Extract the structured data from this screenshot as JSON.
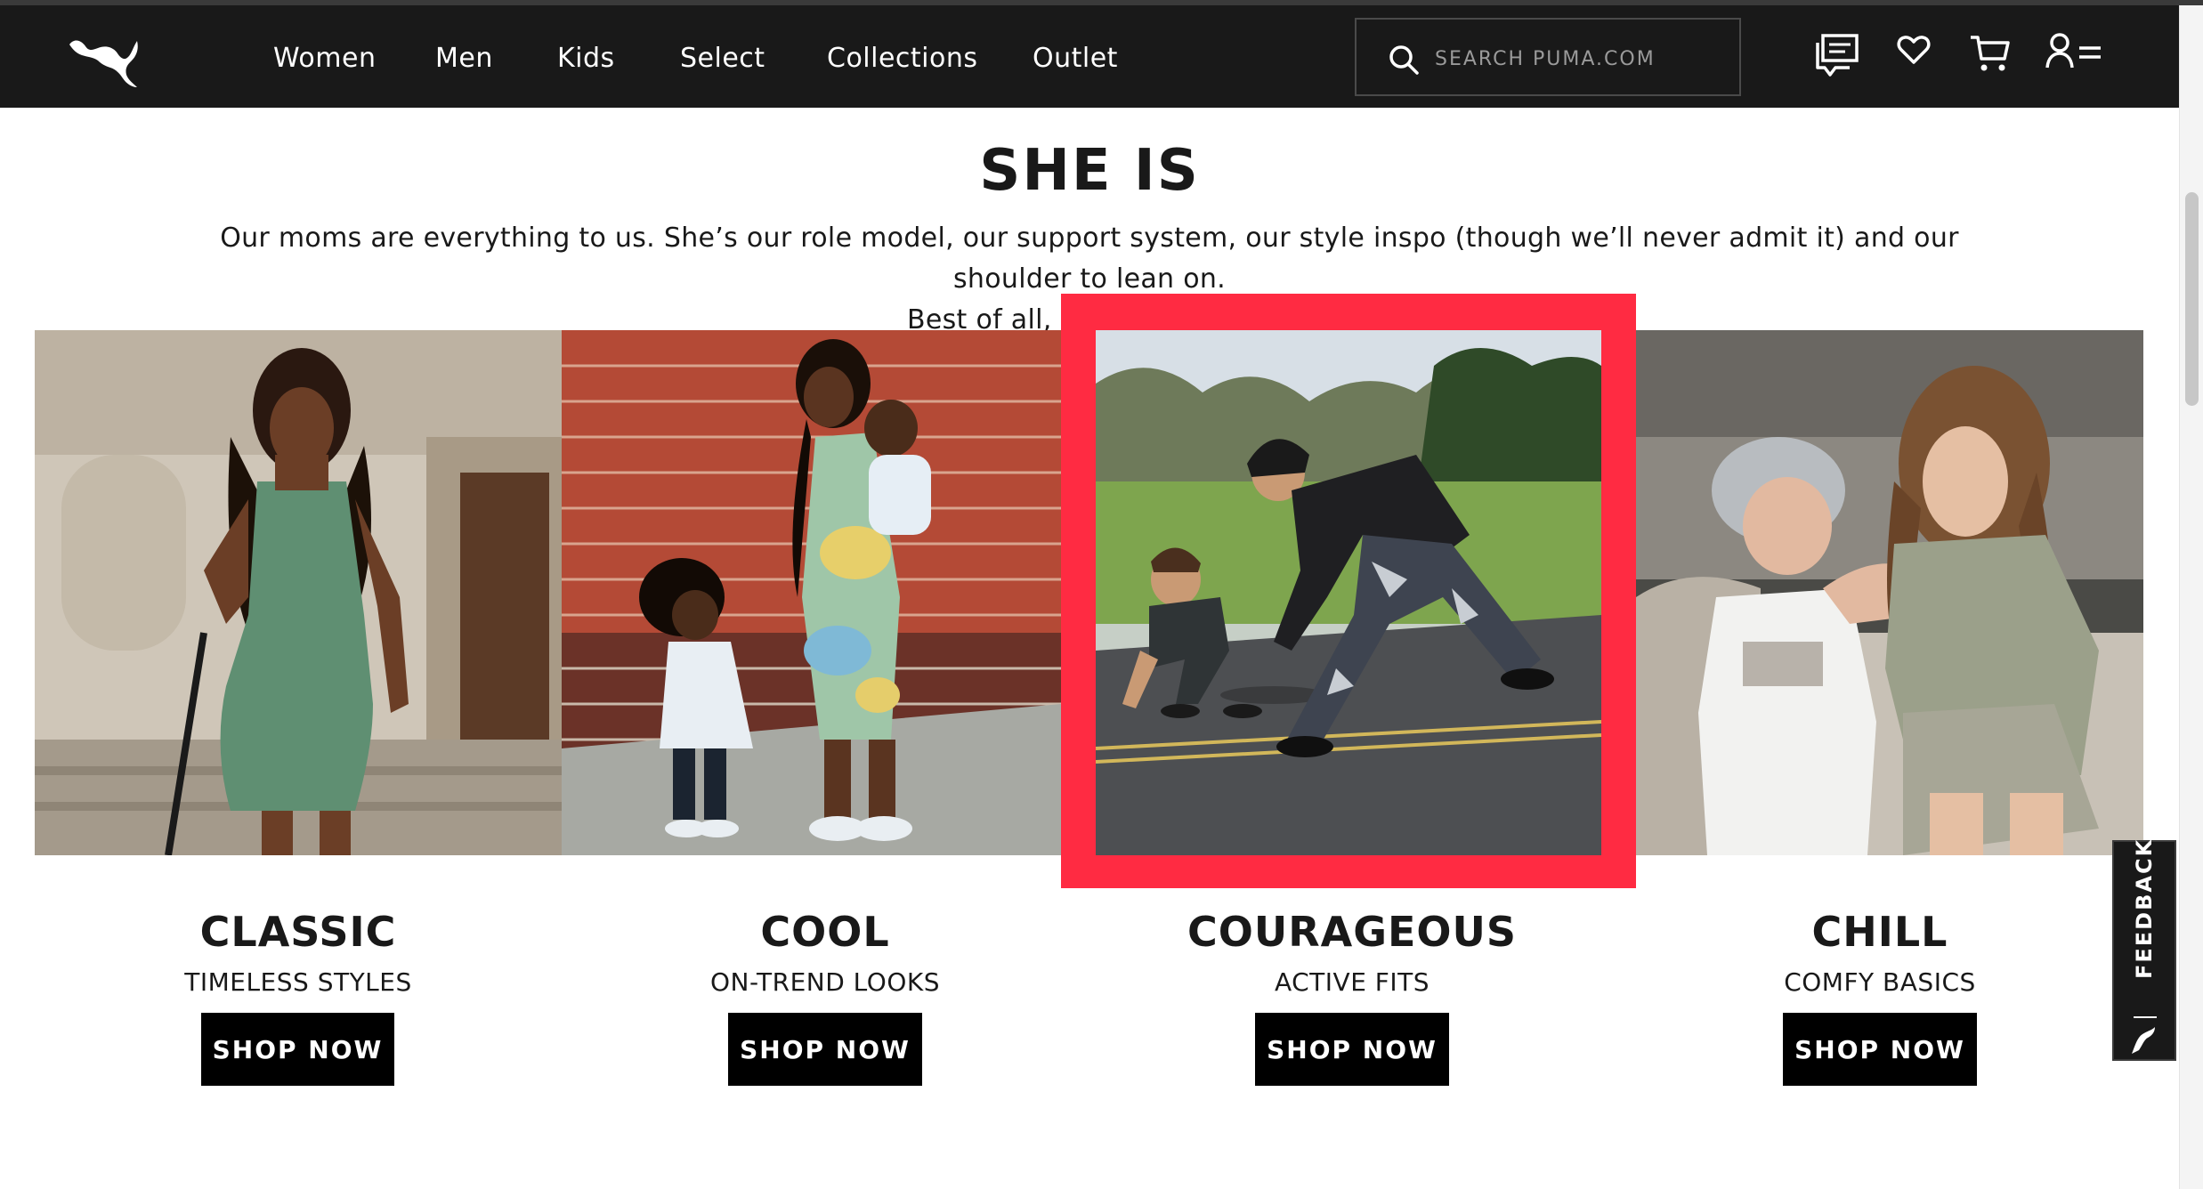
{
  "nav": {
    "items": [
      "Women",
      "Men",
      "Kids",
      "Select",
      "Collections",
      "Outlet"
    ],
    "search_placeholder": "SEARCH PUMA.COM"
  },
  "hero": {
    "title": "SHE IS",
    "line1": "Our moms are everything to us. She’s our role model, our support system, our style inspo (though we’ll never admit it) and our shoulder to lean on.",
    "line2": "Best of all, she’s our mom."
  },
  "cards": [
    {
      "title": "CLASSIC",
      "subtitle": "TIMELESS STYLES",
      "button": "SHOP NOW"
    },
    {
      "title": "COOL",
      "subtitle": "ON-TREND LOOKS",
      "button": "SHOP NOW"
    },
    {
      "title": "COURAGEOUS",
      "subtitle": "ACTIVE FITS",
      "button": "SHOP NOW"
    },
    {
      "title": "CHILL",
      "subtitle": "COMFY BASICS",
      "button": "SHOP NOW"
    }
  ],
  "feedback": {
    "label": "FEEDBACK"
  },
  "colors": {
    "nav_bg": "#191919",
    "highlight": "#ff2b42",
    "button_bg": "#000000",
    "text": "#191919"
  },
  "icons": [
    "puma-logo-icon",
    "search-icon",
    "chat-icon",
    "heart-icon",
    "cart-icon",
    "account-menu-icon"
  ]
}
